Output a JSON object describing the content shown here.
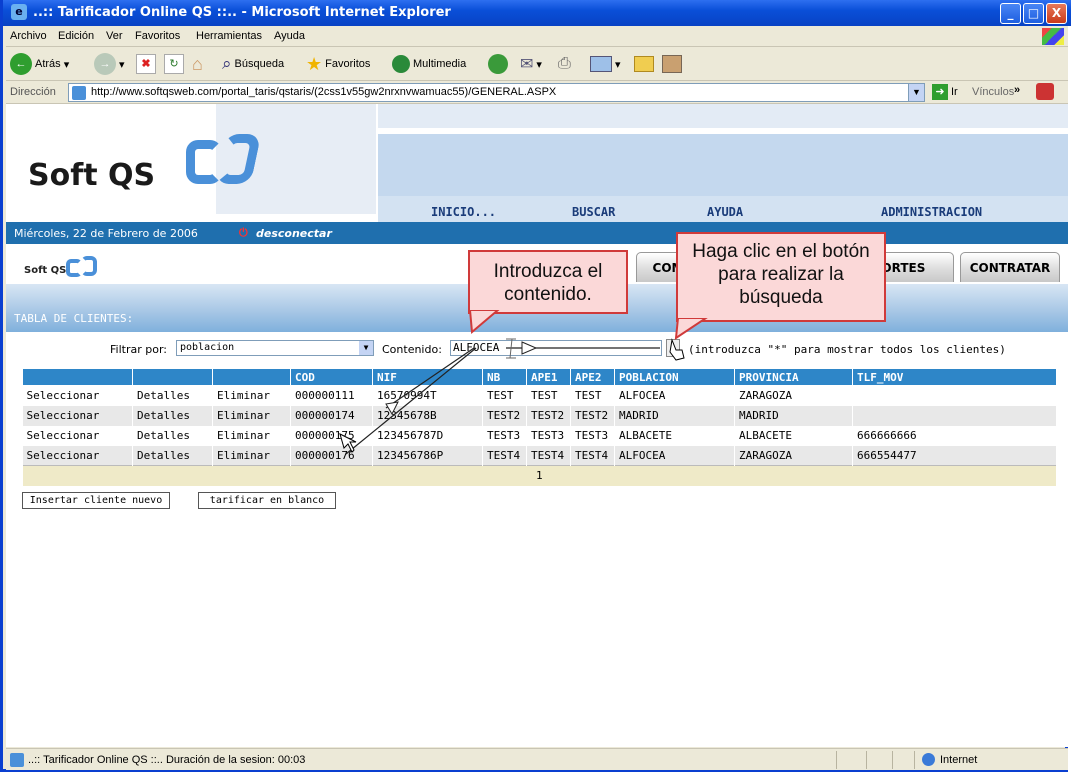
{
  "window": {
    "title": "..:: Tarificador Online QS ::.. - Microsoft Internet Explorer",
    "min": "_",
    "max": "□",
    "close": "X"
  },
  "menu": [
    "Archivo",
    "Edición",
    "Ver",
    "Favoritos",
    "Herramientas",
    "Ayuda"
  ],
  "toolbar": {
    "back": "Atrás",
    "search": "Búsqueda",
    "favorites": "Favoritos",
    "multimedia": "Multimedia"
  },
  "address": {
    "label": "Dirección",
    "url": "http://www.softqsweb.com/portal_taris/qstaris/(2css1v55gw2nrxnvwamuac55)/GENERAL.ASPX",
    "go": "Ir",
    "links": "Vínculos"
  },
  "site": {
    "logo": "Soft QS",
    "nav": [
      "INICIO...",
      "BUSCAR",
      "AYUDA",
      "ADMINISTRACION"
    ],
    "date": "Miércoles, 22 de Febrero de 2006",
    "disconnect": "desconectar",
    "small_logo": "Soft QS",
    "tabs": [
      "COM",
      "PORTES",
      "CONTRATAR"
    ],
    "section_title": "TABLA DE CLIENTES:"
  },
  "filter": {
    "label": "Filtrar por:",
    "selected": "poblacion",
    "content_label": "Contenido:",
    "content_value": "ALFOCEA",
    "hint": "(introduzca \"*\" para mostrar todos los clientes)"
  },
  "table": {
    "headers": [
      "",
      "",
      "",
      "COD",
      "NIF",
      "NB",
      "APE1",
      "APE2",
      "POBLACION",
      "PROVINCIA",
      "TLF_MOV"
    ],
    "rows": [
      [
        "Seleccionar",
        "Detalles",
        "Eliminar",
        "000000111",
        "16570994T",
        "TEST",
        "TEST",
        "TEST",
        "ALFOCEA",
        "ZARAGOZA",
        ""
      ],
      [
        "Seleccionar",
        "Detalles",
        "Eliminar",
        "000000174",
        "12345678B",
        "TEST2",
        "TEST2",
        "TEST2",
        "MADRID",
        "MADRID",
        ""
      ],
      [
        "Seleccionar",
        "Detalles",
        "Eliminar",
        "000000175",
        "123456787D",
        "TEST3",
        "TEST3",
        "TEST3",
        "ALBACETE",
        "ALBACETE",
        "666666666"
      ],
      [
        "Seleccionar",
        "Detalles",
        "Eliminar",
        "000000176",
        "123456786P",
        "TEST4",
        "TEST4",
        "TEST4",
        "ALFOCEA",
        "ZARAGOZA",
        "666554477"
      ]
    ],
    "pager": "1"
  },
  "buttons": {
    "new_client": "Insertar cliente nuevo",
    "blank": "tarificar en blanco"
  },
  "callouts": {
    "left": "Introduzca el contenido.",
    "right": "Haga clic en el botón para realizar la búsqueda"
  },
  "status": {
    "text": "..:: Tarificador Online QS ::.. Duración de la sesion: 00:03",
    "zone": "Internet"
  },
  "colors": {
    "titlebar": "#0a4fd8",
    "header_band": "#1f6fae",
    "table_header": "#2e86c8",
    "callout_border": "#d03a3a",
    "callout_fill": "#fbd8d8"
  }
}
